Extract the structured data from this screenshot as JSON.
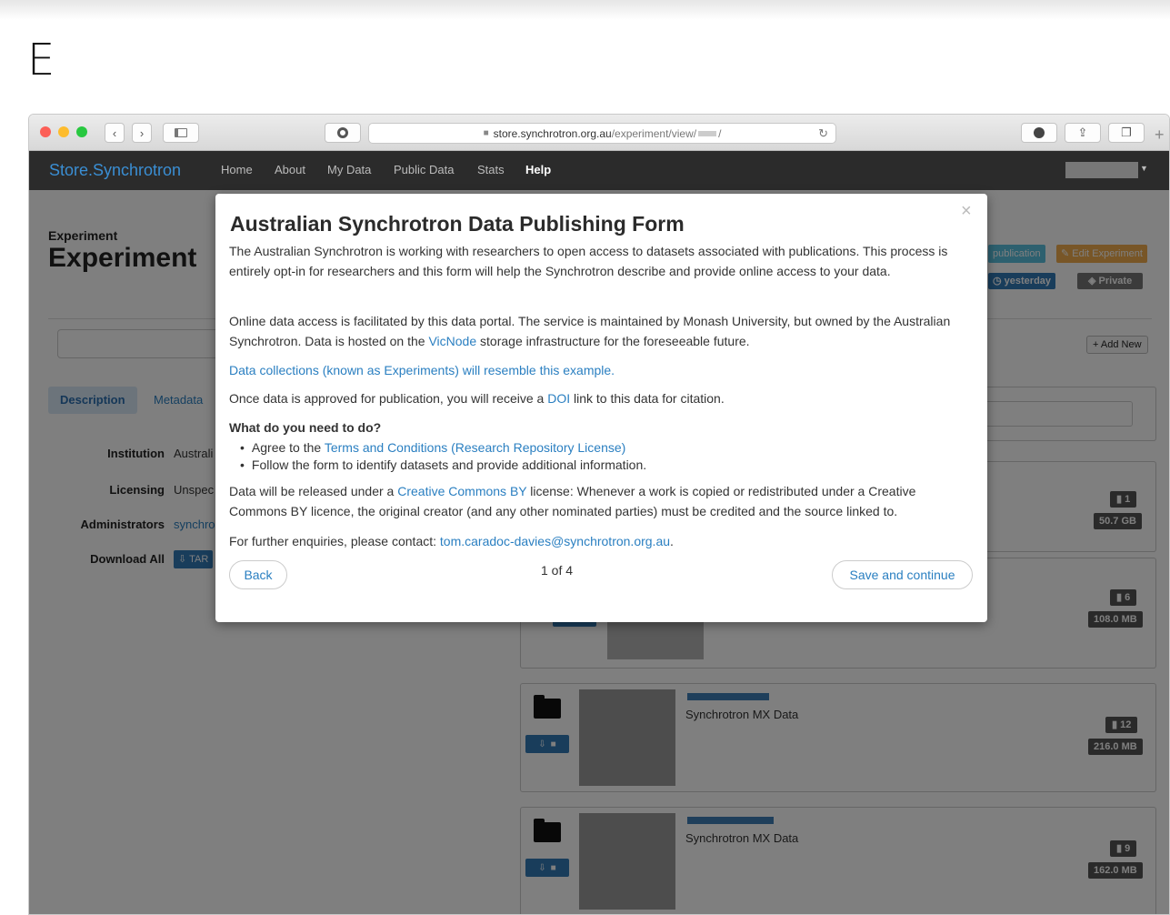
{
  "panel": {
    "letter": "E"
  },
  "browser": {
    "url_host": "store.synchrotron.org.au",
    "url_path": "/experiment/view/",
    "url_tail": "/"
  },
  "nav": {
    "brand": "Store.Synchrotron",
    "items": [
      "Home",
      "About",
      "My Data",
      "Public Data",
      "Stats",
      "Help"
    ]
  },
  "page": {
    "small_title": "Experiment",
    "big_title": "Experiment",
    "btn_publication": "publication",
    "btn_edit": "Edit Experiment",
    "badge_date": "yesterday",
    "badge_private": "Private",
    "btn_add_new": "+ Add New",
    "tabs": [
      "Description",
      "Metadata"
    ],
    "meta": [
      {
        "label": "Institution",
        "value": "Australi"
      },
      {
        "label": "Licensing",
        "value": "Unspec"
      },
      {
        "label": "Administrators",
        "value": "synchro"
      },
      {
        "label": "Download All",
        "value": "TAR"
      }
    ],
    "datasets": [
      {
        "type": "",
        "count": "1",
        "size": "50.7 GB"
      },
      {
        "type": "",
        "count": "6",
        "size": "108.0 MB"
      },
      {
        "type": "Synchrotron MX Data",
        "count": "12",
        "size": "216.0 MB"
      },
      {
        "type": "Synchrotron MX Data",
        "count": "9",
        "size": "162.0 MB"
      }
    ]
  },
  "modal": {
    "title": "Australian Synchrotron Data Publishing Form",
    "close": "×",
    "p1": "The Australian Synchrotron is working with researchers to open access to datasets associated with publications. This process is entirely opt-in for researchers and this form will help the Synchrotron describe and provide online access to your data.",
    "p2_a": "Online data access is facilitated by this data portal. The service is maintained by Monash University, but owned by the Australian Synchrotron. Data is hosted on the ",
    "p2_link": "VicNode",
    "p2_b": " storage infrastructure for the foreseeable future.",
    "p3_link": "Data collections (known as Experiments) will resemble this example.",
    "p4_a": "Once data is approved for publication, you will receive a ",
    "p4_link": "DOI",
    "p4_b": " link to this data for citation.",
    "todo_heading": "What do you need to do?",
    "todo1_a": "Agree to the ",
    "todo1_link": "Terms and Conditions (Research Repository License)",
    "todo2": "Follow the form to identify datasets and provide additional information.",
    "p5_a": "Data will be released under a ",
    "p5_link": "Creative Commons BY",
    "p5_b": " license: Whenever a work is copied or redistributed under a Creative Commons BY licence, the original creator (and any other nominated parties) must be credited and the source linked to.",
    "p6_a": "For further enquiries, please contact: ",
    "p6_link": "tom.caradoc-davies@synchrotron.org.au",
    "p6_b": ".",
    "back": "Back",
    "pager": "1 of 4",
    "save": "Save and continue"
  }
}
